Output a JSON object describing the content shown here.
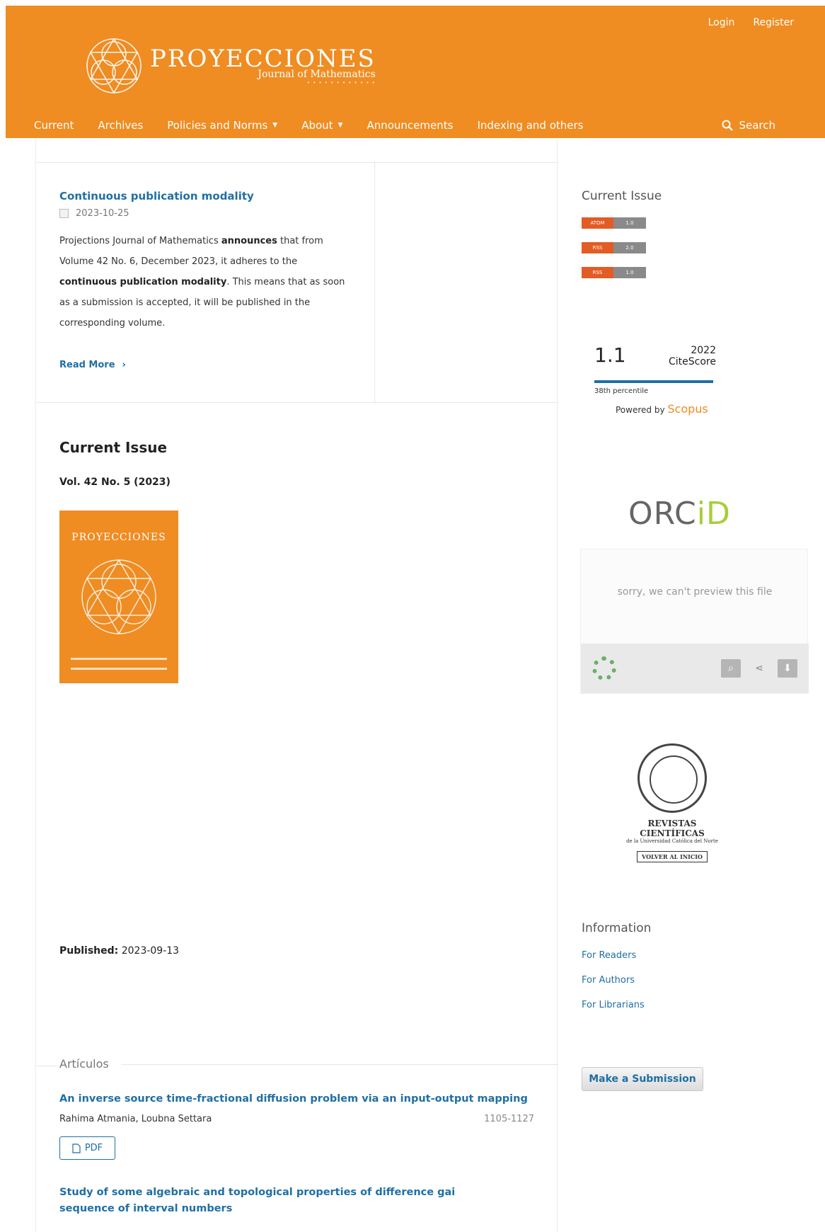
{
  "header": {
    "logo_title": "PROYECCIONES",
    "logo_subtitle": "Journal of Mathematics",
    "user_nav": {
      "login": "Login",
      "register": "Register"
    },
    "main_nav": [
      {
        "label": "Current"
      },
      {
        "label": "Archives"
      },
      {
        "label": "Policies and Norms"
      },
      {
        "label": "About"
      },
      {
        "label": "Announcements"
      },
      {
        "label": "Indexing and others"
      }
    ],
    "search_label": "Search"
  },
  "announcement": {
    "title": "Continuous publication modality",
    "date": "2023-10-25",
    "body_1": "Projections Journal of Mathematics ",
    "body_2": "announces",
    "body_3": " that from Volume 42 No. 6, December 2023, it adheres to the ",
    "body_4": "continuous publication modality",
    "body_5": ". This means that as soon as a submission is accepted, it will be published in the corresponding volume.",
    "read_more": "Read More"
  },
  "current_issue": {
    "heading": "Current Issue",
    "volume": "Vol. 42 No. 5 (2023)",
    "cover_title": "PROYECCIONES",
    "published_label": "Published:",
    "published_date": "2023-09-13"
  },
  "section": {
    "label": "Artículos",
    "articles": [
      {
        "title": "An inverse source time-fractional diffusion problem via an input-output mapping",
        "authors": "Rahima Atmania, Loubna Settara",
        "pages": "1105-1127",
        "pdf_label": "PDF"
      },
      {
        "title": "Study of some algebraic and topological properties of difference gai sequence of interval numbers"
      }
    ]
  },
  "sidebar": {
    "current_issue_heading": "Current Issue",
    "citescore": {
      "score": "1.1",
      "year": "2022",
      "label": "CiteScore",
      "percentile": "38th percentile",
      "powered_by": "Powered by",
      "scopus": "Scopus"
    },
    "orcid": {
      "main": "ORC",
      "id": "iD"
    },
    "viewer_message": "sorry, we can't preview this file",
    "ucn": {
      "name": "REVISTAS CIENTÍFICAS",
      "sub": "de la Universidad Católica del Norte",
      "back": "VOLVER AL INICIO"
    },
    "information_heading": "Information",
    "info_links": [
      "For Readers",
      "For Authors",
      "For Librarians"
    ],
    "submit_label": "Make a Submission"
  },
  "colors": {
    "brand_orange": "#ef8c22",
    "link_blue": "#1f6fa5",
    "orcid_green": "#a6ce39"
  }
}
